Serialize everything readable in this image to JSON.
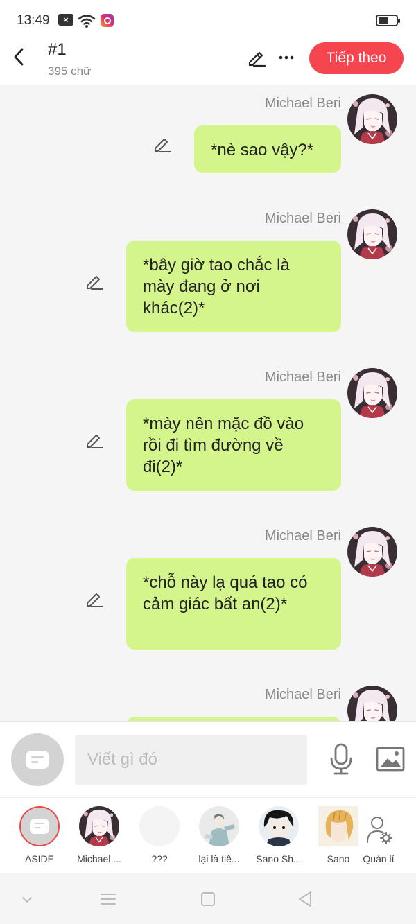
{
  "status_bar": {
    "time": "13:49",
    "notification_glyph": "×"
  },
  "header": {
    "title": "#1",
    "word_count": "395 chữ",
    "next_label": "Tiếp theo"
  },
  "messages": [
    {
      "sender": "Michael Beri",
      "text": "*nè sao vậy?*"
    },
    {
      "sender": "Michael Beri",
      "text": "*bây giờ tao chắc là mày đang ở nơi khác(2)*"
    },
    {
      "sender": "Michael Beri",
      "text": "*mày nên mặc đồ vào rồi đi tìm đường về đi(2)*"
    },
    {
      "sender": "Michael Beri",
      "text": "*chỗ này lạ quá tao có cảm giác bất an(2)*"
    },
    {
      "sender": "Michael Beri",
      "text": ""
    }
  ],
  "input": {
    "placeholder": "Viết gì đó"
  },
  "characters": [
    {
      "name": "ASIDE"
    },
    {
      "name": "Michael ..."
    },
    {
      "name": "???"
    },
    {
      "name": "lại là tiê..."
    },
    {
      "name": "Sano Sh..."
    },
    {
      "name": "Sano"
    }
  ],
  "manage_label": "Quản lí",
  "colors": {
    "accent": "#f5454e",
    "bubble": "#d4f48c",
    "background": "#f5f5f5"
  }
}
